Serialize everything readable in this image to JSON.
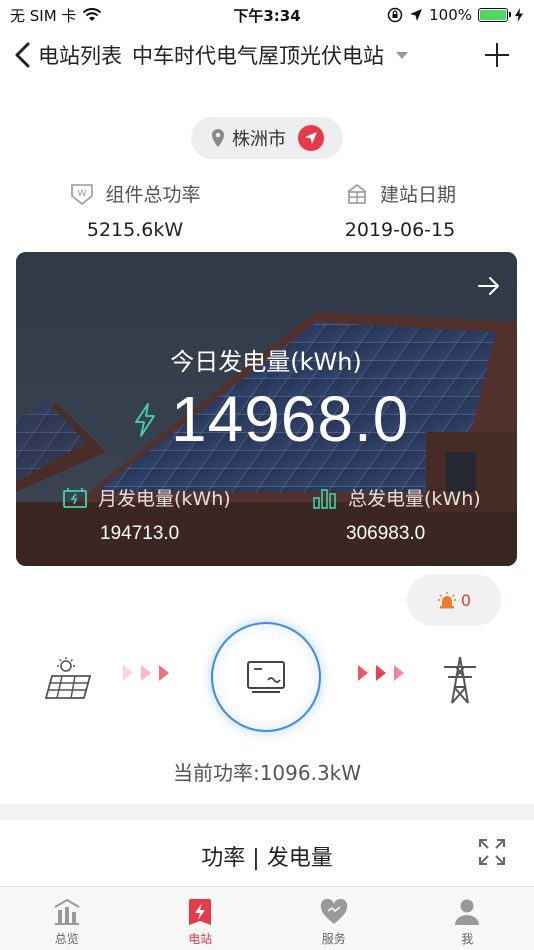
{
  "status_bar": {
    "carrier": "无 SIM 卡",
    "time": "下午3:34",
    "battery": "100%"
  },
  "nav": {
    "back_label": "电站列表",
    "title": "中车时代电气屋顶光伏电站"
  },
  "location": {
    "city": "株洲市"
  },
  "info": {
    "power_label": "组件总功率",
    "power_value": "5215.6kW",
    "date_label": "建站日期",
    "date_value": "2019-06-15"
  },
  "hero": {
    "today_label": "今日发电量(kWh)",
    "today_value": "14968.0",
    "month_label": "月发电量(kWh)",
    "month_value": "194713.0",
    "total_label": "总发电量(kWh)",
    "total_value": "306983.0"
  },
  "alarm": {
    "count": "0"
  },
  "flow": {
    "current_power": "当前功率:1096.3kW"
  },
  "section": {
    "title": "功率 | 发电量"
  },
  "tabs": [
    {
      "label": "总览",
      "icon": "overview-chart-icon"
    },
    {
      "label": "电站",
      "icon": "station-bolt-icon"
    },
    {
      "label": "服务",
      "icon": "heart-service-icon"
    },
    {
      "label": "我",
      "icon": "user-profile-icon"
    }
  ],
  "colors": {
    "accent": "#e8394a",
    "inverter_ring": "#3b8be8",
    "hero_icon": "#3ed6b0"
  }
}
